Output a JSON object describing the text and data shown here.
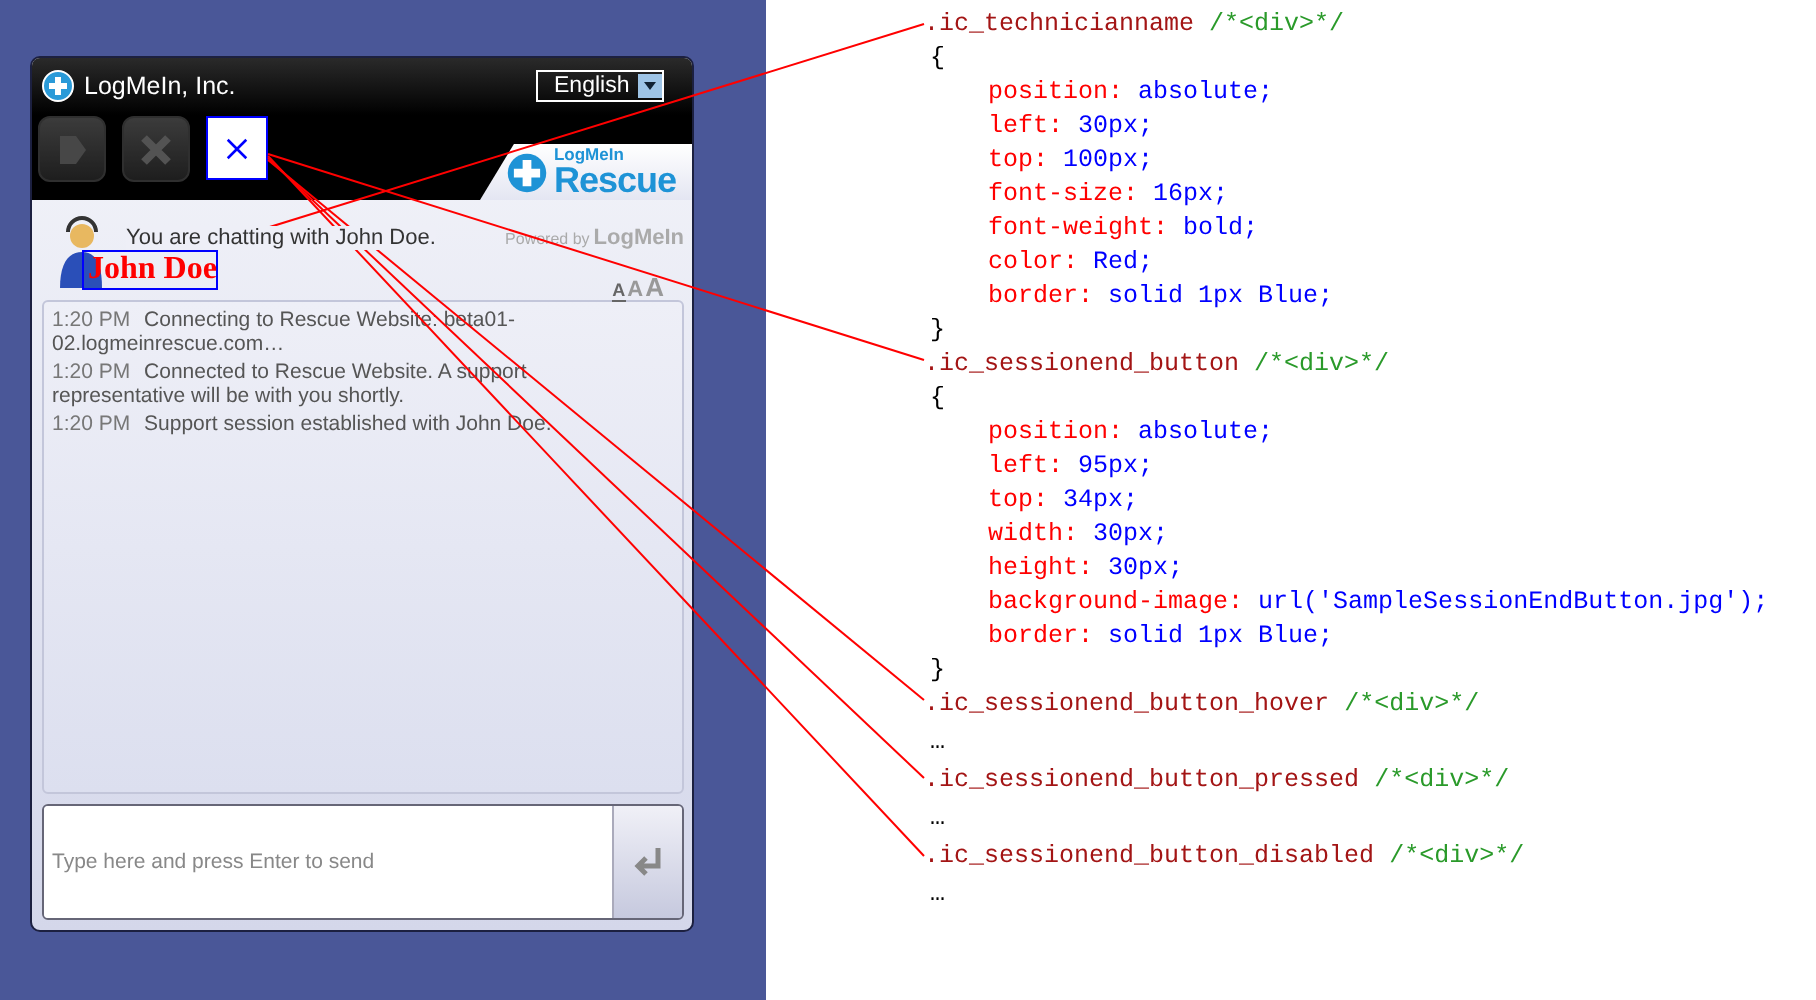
{
  "app": {
    "title": "LogMeIn, Inc.",
    "language": "English",
    "toolbar": [
      {
        "kind": "forward",
        "disabled": true
      },
      {
        "kind": "close",
        "disabled": true
      },
      {
        "kind": "sample-close",
        "disabled": false
      }
    ],
    "logo": {
      "line_1": "LogMeIn",
      "line_2": "Rescue"
    },
    "chat_with": "You are chatting with John Doe.",
    "technician_name": "John Doe",
    "powered_by": {
      "label": "Powered by",
      "brand": "LogMeIn"
    },
    "font_sizes": [
      {
        "label": "A",
        "selected": true
      },
      {
        "label": "A",
        "selected": false
      },
      {
        "label": "A",
        "selected": false
      }
    ],
    "messages": [
      {
        "time": "1:20 PM",
        "text": "Connecting to Rescue Website: beta01-02.logmeinrescue.com…"
      },
      {
        "time": "1:20 PM",
        "text": "Connected to Rescue Website. A support representative will be with you shortly."
      },
      {
        "time": "1:20 PM",
        "text": "Support session established with John Doe."
      }
    ],
    "input": {
      "placeholder": "Type here and press Enter to send"
    }
  },
  "code_lines": [
    {
      "kind": "selector",
      "name": ".ic_technicianname",
      "comment": "/*<div>*/"
    },
    {
      "kind": "brace",
      "text": "{"
    },
    {
      "kind": "property",
      "name": "position:",
      "value": "absolute;"
    },
    {
      "kind": "property",
      "name": "left:",
      "value": "30px;"
    },
    {
      "kind": "property",
      "name": "top:",
      "value": "100px;"
    },
    {
      "kind": "property",
      "name": "font-size:",
      "value": "16px;"
    },
    {
      "kind": "property",
      "name": "font-weight:",
      "value": "bold;"
    },
    {
      "kind": "property",
      "name": "color:",
      "value": "Red;"
    },
    {
      "kind": "property",
      "name": "border:",
      "value": "solid 1px Blue;"
    },
    {
      "kind": "brace",
      "text": "}"
    },
    {
      "kind": "selector",
      "name": ".ic_sessionend_button",
      "comment": "/*<div>*/"
    },
    {
      "kind": "brace",
      "text": "{"
    },
    {
      "kind": "property",
      "name": "position:",
      "value": "absolute;"
    },
    {
      "kind": "property",
      "name": "left:",
      "value": "95px;"
    },
    {
      "kind": "property",
      "name": "top:",
      "value": "34px;"
    },
    {
      "kind": "property",
      "name": "width:",
      "value": "30px;"
    },
    {
      "kind": "property",
      "name": "height:",
      "value": "30px;"
    },
    {
      "kind": "property",
      "name": "background-image:",
      "value": "url('SampleSessionEndButton.jpg');"
    },
    {
      "kind": "property",
      "name": "border:",
      "value": "solid 1px Blue;"
    },
    {
      "kind": "brace",
      "text": "}"
    },
    {
      "kind": "selector",
      "name": ".ic_sessionend_button_hover",
      "comment": "/*<div>*/"
    },
    {
      "kind": "ellipsis",
      "text": "…"
    },
    {
      "kind": "selector",
      "name": ".ic_sessionend_button_pressed",
      "comment": "/*<div>*/"
    },
    {
      "kind": "ellipsis",
      "text": "…"
    },
    {
      "kind": "selector",
      "name": ".ic_sessionend_button_disabled",
      "comment": "/*<div>*/"
    },
    {
      "kind": "ellipsis",
      "text": "…"
    }
  ]
}
